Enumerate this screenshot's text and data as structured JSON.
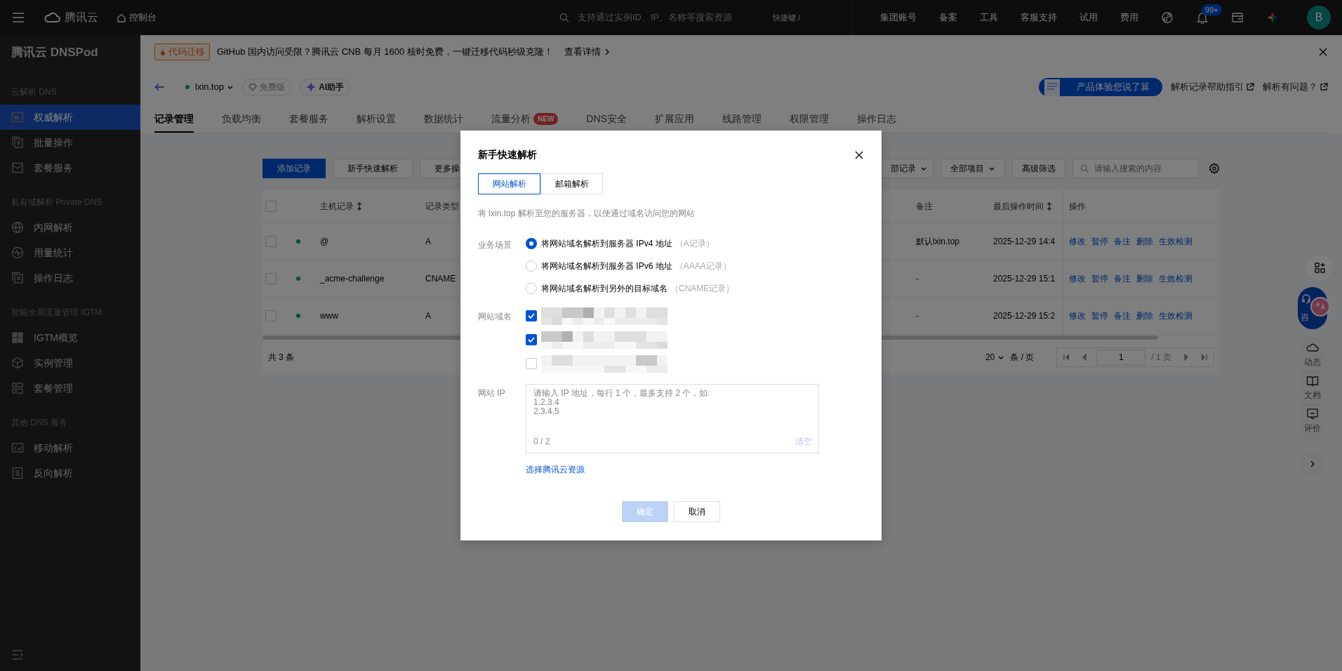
{
  "top_bar": {
    "logo": "腾讯云",
    "console": "控制台",
    "search": {
      "placeholder": "支持通过实例ID、IP、名称等搜索资源"
    },
    "shortcut": "快捷键 /",
    "links": [
      "集团账号",
      "备案",
      "工具",
      "客服支持",
      "试用",
      "费用"
    ],
    "notification_count": "99+",
    "avatar": "B"
  },
  "sidebar": {
    "title": "腾讯云 DNSPod",
    "groups": [
      {
        "heading": "云解析 DNS",
        "items": [
          {
            "label": "权威解析",
            "selected": true
          },
          {
            "label": "批量操作",
            "selected": false
          },
          {
            "label": "套餐服务",
            "selected": false
          }
        ]
      },
      {
        "heading": "私有域解析 Private DNS",
        "items": [
          {
            "label": "内网解析",
            "selected": false
          },
          {
            "label": "用量统计",
            "selected": false
          },
          {
            "label": "操作日志",
            "selected": false
          }
        ]
      },
      {
        "heading": "智能全局流量管理 IGTM",
        "items": [
          {
            "label": "IGTM概览",
            "selected": false
          },
          {
            "label": "实例管理",
            "selected": false
          },
          {
            "label": "套餐管理",
            "selected": false
          }
        ]
      },
      {
        "heading": "其他 DNS 服务",
        "items": [
          {
            "label": "移动解析",
            "selected": false
          },
          {
            "label": "反向解析",
            "selected": false
          }
        ]
      }
    ]
  },
  "banner": {
    "tag": "代码迁移",
    "text": "GitHub 国内访问受限？腾讯云 CNB 每月 1600 核时免费，一键迁移代码秒级克隆！",
    "link": "查看详情"
  },
  "header": {
    "domain": "lxin.top",
    "enabled": true,
    "plan": "免费版",
    "assistant": "AI助手",
    "feedback": "产品体验您说了算",
    "help_links": [
      "解析记录帮助指引",
      "解析有问题？"
    ]
  },
  "tabs": [
    {
      "label": "记录管理",
      "selected": true
    },
    {
      "label": "负载均衡",
      "selected": false
    },
    {
      "label": "套餐服务",
      "selected": false
    },
    {
      "label": "解析设置",
      "selected": false
    },
    {
      "label": "数据统计",
      "selected": false
    },
    {
      "label": "流量分析",
      "selected": false,
      "badge": "NEW"
    },
    {
      "label": "DNS安全",
      "selected": false
    },
    {
      "label": "扩展应用",
      "selected": false
    },
    {
      "label": "线路管理",
      "selected": false
    },
    {
      "label": "权限管理",
      "selected": false
    },
    {
      "label": "操作日志",
      "selected": false
    }
  ],
  "toolbar": {
    "buttons": [
      "添加记录",
      "新手快速解析",
      "更多操"
    ],
    "filters": [
      "部记录",
      "全部项目"
    ],
    "advanced_filter": "高级筛选",
    "search": {
      "placeholder": "请输入搜索的内容"
    }
  },
  "table": {
    "all_checked": false,
    "columns": [
      {
        "label": "主机记录",
        "sortable": true
      },
      {
        "label": "记录类型",
        "sortable": false
      },
      {
        "label": "备注",
        "sortable": false
      },
      {
        "label": "最后操作时间",
        "sortable": true
      },
      {
        "label": "操作",
        "sortable": false
      }
    ],
    "rows": [
      {
        "checked": false,
        "enabled": true,
        "host": "@",
        "type": "A",
        "remark": "默认lxin.top",
        "updated": "2025-12-29 14:4",
        "actions": [
          "修改",
          "暂停",
          "备注",
          "删除",
          "生效检测"
        ]
      },
      {
        "checked": false,
        "enabled": true,
        "host": "_acme-challenge",
        "type": "CNAME",
        "remark": "-",
        "updated": "2025-12-29 15:1",
        "actions": [
          "修改",
          "暂停",
          "备注",
          "删除",
          "生效检测"
        ]
      },
      {
        "checked": false,
        "enabled": true,
        "host": "www",
        "type": "A",
        "remark": "-",
        "updated": "2025-12-29 15:2",
        "actions": [
          "修改",
          "暂停",
          "备注",
          "删除",
          "生效检测"
        ]
      }
    ]
  },
  "pagination": {
    "total": "共 3 条",
    "page_size": "20",
    "page_size_unit": "条 / 页",
    "page": "1",
    "page_count": "/ 1 页"
  },
  "side_widgets": {
    "consult": "咨",
    "items": [
      "动态",
      "文档",
      "评价"
    ]
  },
  "modal": {
    "title": "新手快速解析",
    "tabs": [
      {
        "label": "网站解析",
        "selected": true
      },
      {
        "label": "邮箱解析",
        "selected": false
      }
    ],
    "description": "将 lxin.top 解析至您的服务器，以便通过域名访问您的网站",
    "scenario": {
      "label": "业务场景",
      "options": [
        {
          "label": "将网站域名解析到服务器 IPv4 地址",
          "hint": "（A记录）",
          "selected": true
        },
        {
          "label": "将网站域名解析到服务器 IPv6 地址",
          "hint": "（AAAA记录）",
          "selected": false
        },
        {
          "label": "将网站域名解析到另外的目标域名",
          "hint": "（CNAME记录）",
          "selected": false
        }
      ]
    },
    "domains": {
      "label": "网站域名",
      "items": [
        {
          "checked": true
        },
        {
          "checked": true
        },
        {
          "checked": false
        }
      ]
    },
    "ip": {
      "label": "网站 IP",
      "placeholder": "请输入 IP 地址，每行 1 个，最多支持 2 个，如:\n1.2.3.4\n2.3.4.5",
      "counter": "0 / 2",
      "clear": "清空"
    },
    "resource_link": "选择腾讯云资源",
    "buttons": [
      {
        "label": "确定",
        "disabled": true
      },
      {
        "label": "取消",
        "disabled": false
      }
    ]
  }
}
